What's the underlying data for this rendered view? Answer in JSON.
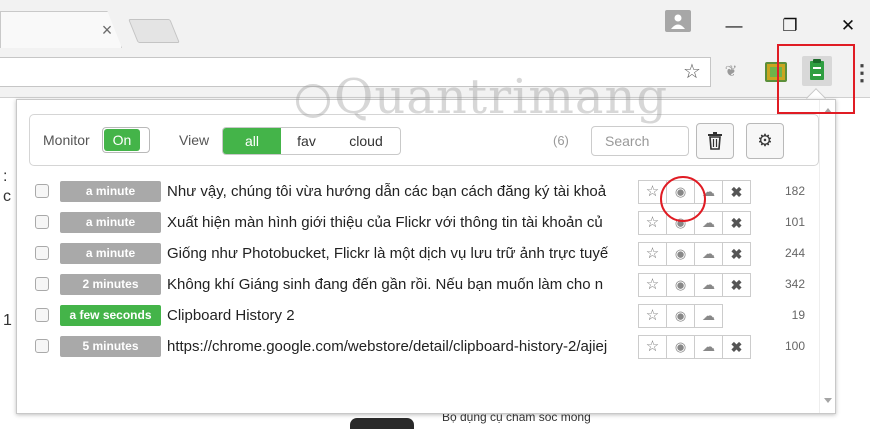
{
  "browser": {
    "tab_close": "×",
    "window_minimize": "—",
    "window_restore": "❐",
    "window_close": "✕",
    "star": "☆",
    "menu": "⋮"
  },
  "background_page": {
    "side_chars": [
      ":",
      "c",
      "1"
    ],
    "caption": "Bộ dụng cụ chăm sóc móng"
  },
  "watermark": "Quantrimang",
  "controls": {
    "monitor_label": "Monitor",
    "monitor_state": "On",
    "view_label": "View",
    "view_options": [
      "all",
      "fav",
      "cloud"
    ],
    "view_selected": "all",
    "count": "(6)",
    "search_placeholder": "Search"
  },
  "items": [
    {
      "time": "a minute",
      "text": "Như vậy, chúng tôi vừa hướng dẫn các bạn cách đăng ký tài khoả",
      "size": "182",
      "has_delete": true
    },
    {
      "time": "a minute",
      "text": "Xuất hiện màn hình giới thiệu của Flickr với thông tin tài khoản củ",
      "size": "101",
      "has_delete": true
    },
    {
      "time": "a minute",
      "text": "Giống như Photobucket, Flickr là một dịch vụ lưu trữ ảnh trực tuyế",
      "size": "244",
      "has_delete": true
    },
    {
      "time": "2 minutes",
      "text": "Không khí Giáng sinh đang đến gần rồi. Nếu bạn muốn làm cho n",
      "size": "342",
      "has_delete": true
    },
    {
      "time": "a few seconds",
      "text": "Clipboard History 2",
      "size": "19",
      "has_delete": false
    },
    {
      "time": "5 minutes",
      "text": "https://chrome.google.com/webstore/detail/clipboard-history-2/ajiej",
      "size": "100",
      "has_delete": true
    }
  ],
  "colors": {
    "accent_green": "#44b449",
    "time_gray": "#a9a9a9",
    "annotation_red": "#e01c24"
  },
  "icons": {
    "star": "☆",
    "eye": "◉",
    "cloud": "☁",
    "delete": "✖",
    "trash": "🗑",
    "gear": "⚙"
  }
}
